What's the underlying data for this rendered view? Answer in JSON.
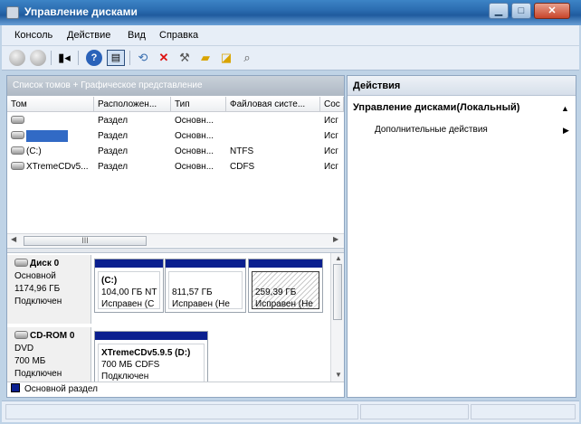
{
  "window": {
    "title": "Управление дисками",
    "controls": {
      "minimize": "▁",
      "maximize": "□",
      "close": "✕"
    }
  },
  "menu": [
    "Консоль",
    "Действие",
    "Вид",
    "Справка"
  ],
  "toolbar": {
    "icons": [
      "back-icon",
      "forward-icon",
      "show-hide-tree-icon",
      "help-icon",
      "properties-icon",
      "refresh-icon",
      "delete-icon",
      "settings-icon",
      "folder-icon",
      "export-icon",
      "search-icon"
    ]
  },
  "left_panel": {
    "header": "Список томов + Графическое представление",
    "columns": [
      "Том",
      "Расположен...",
      "Тип",
      "Файловая систе...",
      "Сос"
    ],
    "rows": [
      {
        "volume": "",
        "location": "Раздел",
        "type": "Основн...",
        "fs": "",
        "status": "Исг"
      },
      {
        "volume": "",
        "location": "Раздел",
        "type": "Основн...",
        "fs": "",
        "status": "Исг"
      },
      {
        "volume": "(C:)",
        "location": "Раздел",
        "type": "Основн...",
        "fs": "NTFS",
        "status": "Исг"
      },
      {
        "volume": "XTremeCDv5...",
        "location": "Раздел",
        "type": "Основн...",
        "fs": "CDFS",
        "status": "Исг"
      }
    ],
    "scroll_thumb": "III",
    "disks": [
      {
        "name": "Диск 0",
        "kind": "Основной",
        "size": "1174,96 ГБ",
        "state": "Подключен",
        "partitions": [
          {
            "label": "(C:)",
            "size": "104,00 ГБ NT",
            "status": "Исправен (С"
          },
          {
            "label": "",
            "size": "811,57 ГБ",
            "status": "Исправен (Не"
          },
          {
            "label": "",
            "size": "259,39 ГБ",
            "status": "Исправен (Не"
          }
        ]
      },
      {
        "name": "CD-ROM 0",
        "kind": "DVD",
        "size": "700 МБ",
        "state": "Подключен",
        "partitions": [
          {
            "label": "XTremeCDv5.9.5  (D:)",
            "size": "700 МБ CDFS",
            "status": "Подключен"
          }
        ]
      }
    ],
    "legend": "Основной раздел"
  },
  "right_panel": {
    "header": "Действия",
    "section_title": "Управление дисками(Локальный)",
    "items": [
      "Дополнительные действия"
    ]
  },
  "colors": {
    "primary_partition": "#0a1f8f",
    "selection": "#316ac5"
  }
}
